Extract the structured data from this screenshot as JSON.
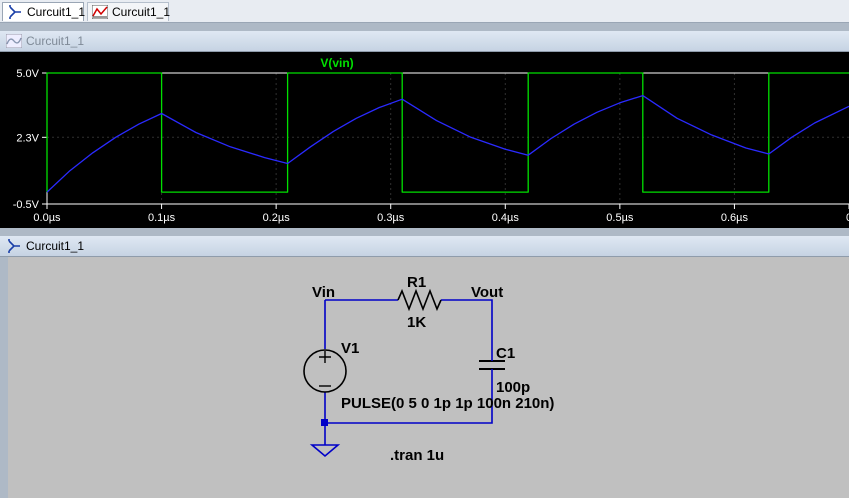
{
  "tabs": [
    {
      "label": "Curcuit1_1",
      "icon": "schematic-icon",
      "active": true
    },
    {
      "label": "Curcuit1_1",
      "icon": "waveform-icon",
      "active": false
    }
  ],
  "waveform_window": {
    "title": "Curcuit1_1",
    "icon": "waveform-icon"
  },
  "schematic_window": {
    "title": "Curcuit1_1",
    "icon": "schematic-icon"
  },
  "chart_data": {
    "type": "line",
    "title": "V(vin)",
    "x_tick_labels": [
      "0.0µs",
      "0.1µs",
      "0.2µs",
      "0.3µs",
      "0.4µs",
      "0.5µs",
      "0.6µs",
      "0"
    ],
    "y_tick_labels": [
      "5.0V",
      "2.3V",
      "-0.5V"
    ],
    "xlim": [
      0,
      0.7
    ],
    "ylim": [
      -0.5,
      5.0
    ],
    "series": [
      {
        "name": "V(vin)",
        "color": "#00e000",
        "x": [
          0,
          0,
          0.1,
          0.1,
          0.21,
          0.21,
          0.31,
          0.31,
          0.42,
          0.42,
          0.52,
          0.52,
          0.63,
          0.63,
          0.7
        ],
        "y": [
          0,
          5,
          5,
          0,
          0,
          5,
          5,
          0,
          0,
          5,
          5,
          0,
          0,
          5,
          5
        ]
      },
      {
        "color": "#2a2aff",
        "x": [
          0,
          0.02,
          0.04,
          0.06,
          0.08,
          0.1,
          0.13,
          0.16,
          0.19,
          0.21,
          0.23,
          0.25,
          0.27,
          0.29,
          0.31,
          0.34,
          0.37,
          0.4,
          0.42,
          0.44,
          0.46,
          0.48,
          0.5,
          0.52,
          0.55,
          0.58,
          0.61,
          0.63,
          0.65,
          0.67,
          0.7
        ],
        "y": [
          0,
          0.9,
          1.65,
          2.3,
          2.85,
          3.3,
          2.5,
          1.9,
          1.45,
          1.2,
          1.9,
          2.55,
          3.1,
          3.55,
          3.9,
          3.0,
          2.3,
          1.8,
          1.55,
          2.25,
          2.85,
          3.35,
          3.75,
          4.05,
          3.1,
          2.4,
          1.85,
          1.6,
          2.3,
          2.9,
          3.6
        ]
      }
    ],
    "grid": true,
    "background": "#000000",
    "axis_color": "#ffffff"
  },
  "schematic": {
    "labels": {
      "vin": "Vin",
      "vout": "Vout",
      "r1_name": "R1",
      "r1_value": "1K",
      "c1_name": "C1",
      "c1_value": "100p",
      "v1_name": "V1",
      "v1_value": "PULSE(0 5 0 1p 1p 100n 210n)",
      "directive": ".tran 1u"
    },
    "wire_color": "#0000c8",
    "background": "#c0c0c0"
  }
}
